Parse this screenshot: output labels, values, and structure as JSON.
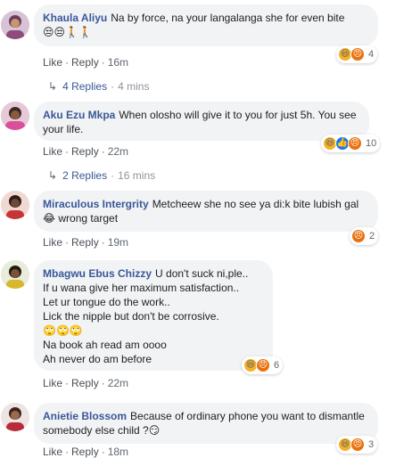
{
  "comments": [
    {
      "author": "Khaula Aliyu",
      "text": "Na by force, na your langalanga she for even bite",
      "emoji": "😒😒🚶🚶",
      "like": "Like",
      "reply": "Reply",
      "time": "16m",
      "reaction_count": "4",
      "reactions": [
        "haha",
        "angry"
      ],
      "replies": {
        "label": "4 Replies",
        "time": "4 mins"
      }
    },
    {
      "author": "Aku Ezu Mkpa",
      "text": "When olosho will give it to you for just 5h. You see your life.",
      "like": "Like",
      "reply": "Reply",
      "time": "22m",
      "reaction_count": "10",
      "reactions": [
        "haha",
        "like",
        "angry"
      ],
      "replies": {
        "label": "2 Replies",
        "time": "16 mins"
      }
    },
    {
      "author": "Miraculous Intergrity",
      "text": "Metcheew she no see ya di:k bite lubish gal 😂 wrong target",
      "like": "Like",
      "reply": "Reply",
      "time": "19m",
      "reaction_count": "2",
      "reactions": [
        "angry"
      ]
    },
    {
      "author": "Mbagwu Ebus Chizzy",
      "text": "U don't suck ni,ple..",
      "lines": [
        "If u wana give her maximum satisfaction..",
        "Let ur tongue do the work..",
        "Lick the nipple but don't be corrosive.",
        "🙄🙄🙄",
        "Na book ah read am oooo",
        "Ah never do am before"
      ],
      "like": "Like",
      "reply": "Reply",
      "time": "22m",
      "reaction_count": "6",
      "reactions": [
        "haha",
        "angry"
      ]
    },
    {
      "author": "Anietie Blossom",
      "text": "Because of ordinary phone you want to dismantle somebody else child ?😏",
      "like": "Like",
      "reply": "Reply",
      "time": "18m",
      "reaction_count": "3",
      "reactions": [
        "haha",
        "angry"
      ]
    }
  ],
  "colors": {
    "author": "#385898",
    "bubble": "#f2f3f5",
    "meta": "#606770"
  }
}
